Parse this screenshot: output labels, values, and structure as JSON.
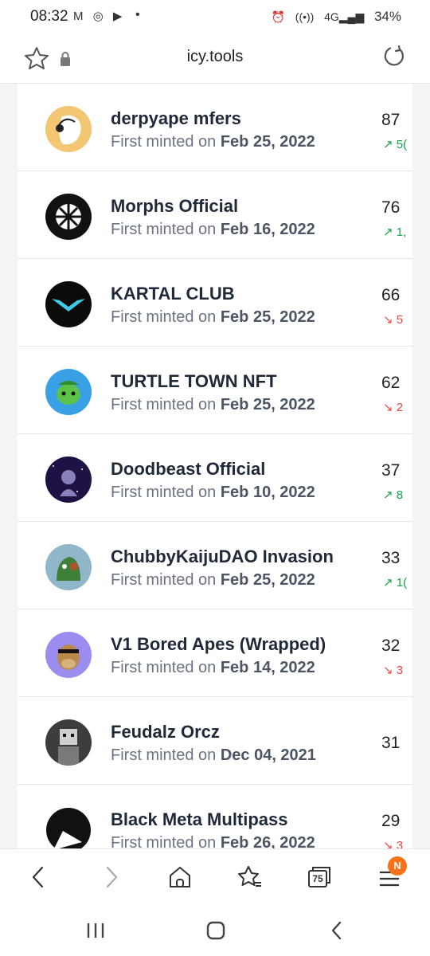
{
  "status": {
    "time": "08:32",
    "battery": "34%"
  },
  "browser": {
    "url": "icy.tools",
    "tabs_count": "75",
    "menu_badge": "N"
  },
  "list": {
    "minted_prefix": "First minted on",
    "items": [
      {
        "name": "derpyape mfers",
        "date": "Feb 25, 2022",
        "count": "87",
        "change": "5(",
        "trend": "up",
        "avatar_color": "#f2c673"
      },
      {
        "name": "Morphs Official",
        "date": "Feb 16, 2022",
        "count": "76",
        "change": "1,",
        "trend": "up",
        "avatar_color": "#111111"
      },
      {
        "name": "KARTAL CLUB",
        "date": "Feb 25, 2022",
        "count": "66",
        "change": "5",
        "trend": "down",
        "avatar_color": "#0b0b0b"
      },
      {
        "name": "TURTLE TOWN NFT",
        "date": "Feb 25, 2022",
        "count": "62",
        "change": "2",
        "trend": "down",
        "avatar_color": "#3aa0e6"
      },
      {
        "name": "Doodbeast Official",
        "date": "Feb 10, 2022",
        "count": "37",
        "change": "8",
        "trend": "up",
        "avatar_color": "#1e1244"
      },
      {
        "name": "ChubbyKaijuDAO Invasion",
        "date": "Feb 25, 2022",
        "count": "33",
        "change": "1(",
        "trend": "up",
        "avatar_color": "#8fb6c9"
      },
      {
        "name": "V1 Bored Apes (Wrapped)",
        "date": "Feb 14, 2022",
        "count": "32",
        "change": "3",
        "trend": "down",
        "avatar_color": "#9b8cf0"
      },
      {
        "name": "Feudalz Orcz",
        "date": "Dec 04, 2021",
        "count": "31",
        "change": "",
        "trend": "none",
        "avatar_color": "#3d3d3d"
      },
      {
        "name": "Black Meta Multipass",
        "date": "Feb 26, 2022",
        "count": "29",
        "change": "3",
        "trend": "down",
        "avatar_color": "#111111"
      }
    ]
  }
}
